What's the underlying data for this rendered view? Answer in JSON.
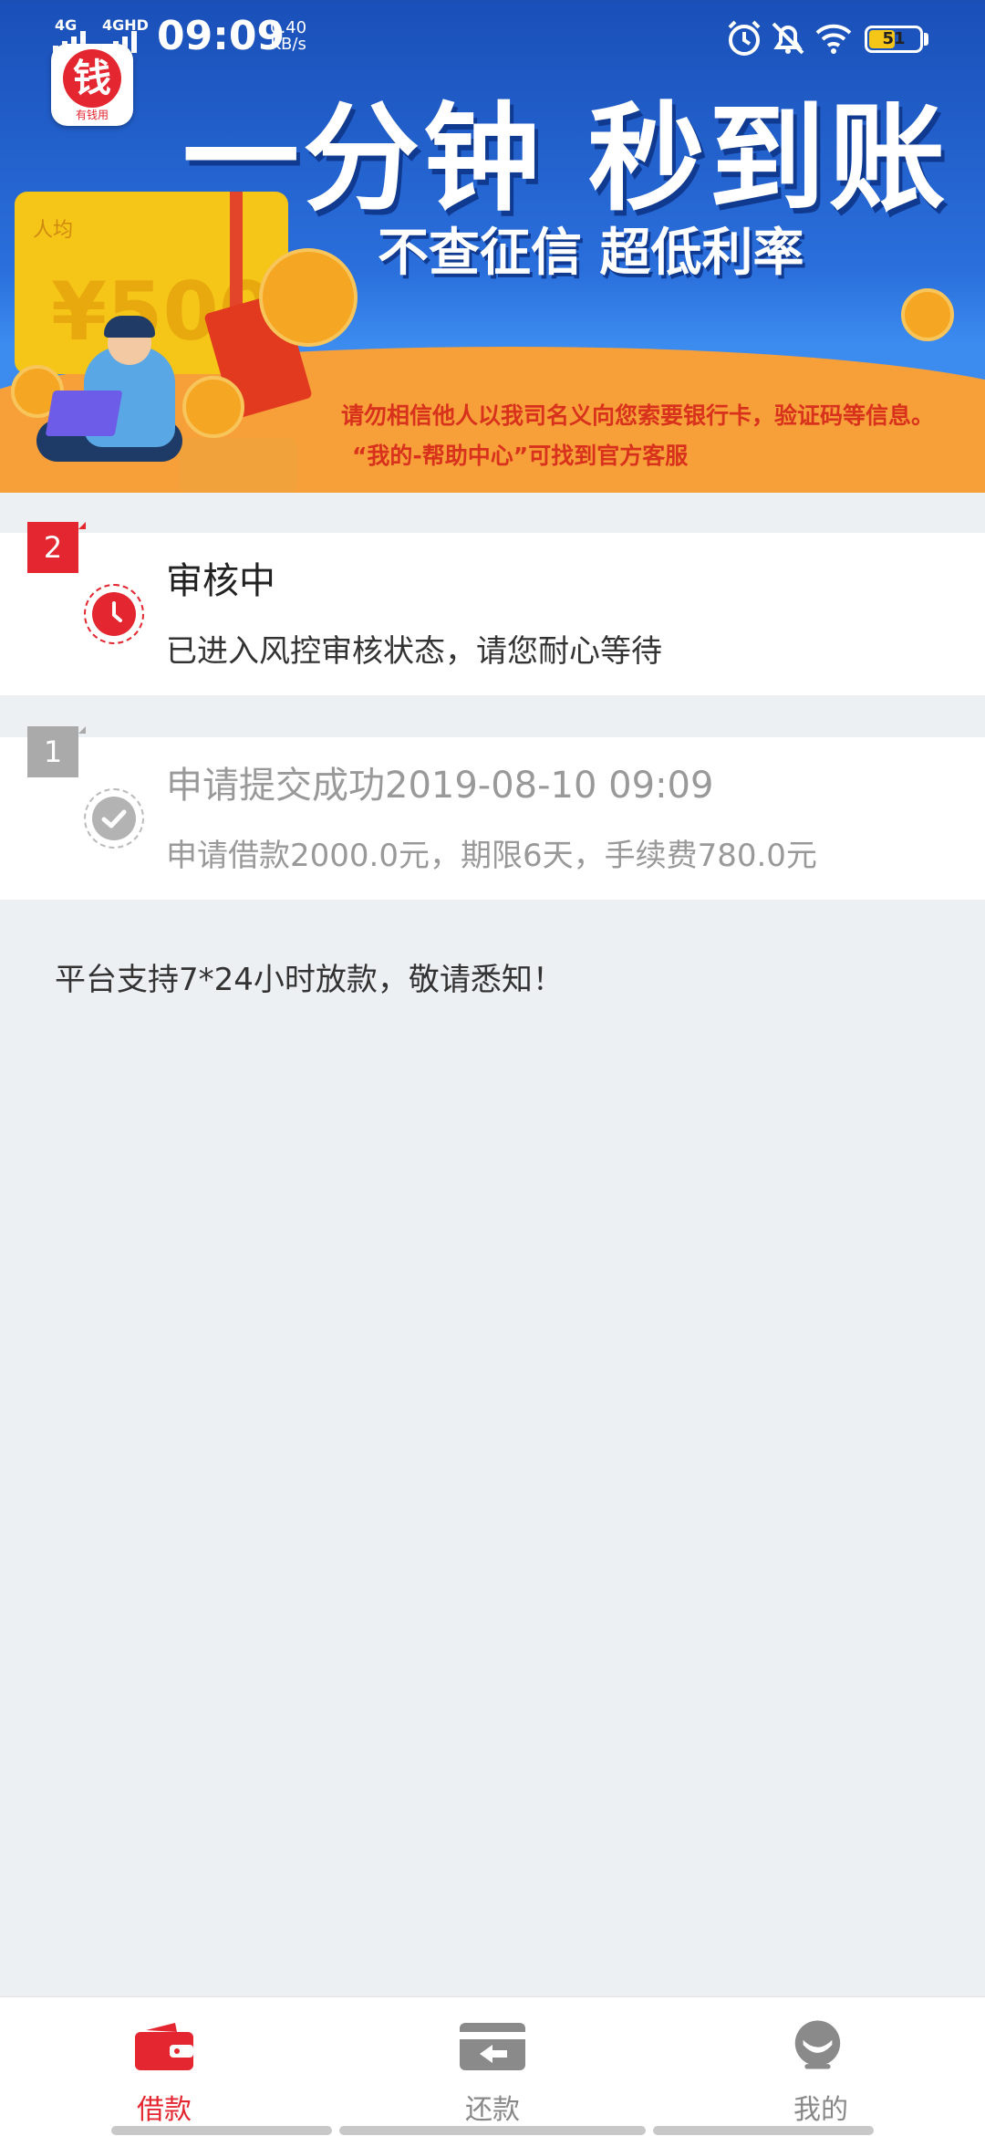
{
  "status_bar": {
    "signal1": "4G",
    "signal2": "4GHD",
    "time": "09:09",
    "net_speed_value": "0.40",
    "net_speed_unit": "KB/s",
    "battery_level": "51",
    "battery_fraction": 0.51,
    "icons": [
      "alarm-icon",
      "mute-bell-icon",
      "wifi-icon",
      "battery-icon"
    ]
  },
  "banner": {
    "app_logo_char": "钱",
    "app_logo_label": "有钱用",
    "title": "一分钟 秒到账",
    "subtitle": "不查征信 超低利率",
    "warning_line1": "请勿相信他人以我司名义向您索要银行卡，验证码等信息。",
    "warning_line2": "“我的-帮助中心”可找到官方客服",
    "card_amount": "¥500",
    "card_label": "人均"
  },
  "steps": [
    {
      "number": "2",
      "title": "审核中",
      "description": "已进入风控审核状态，请您耐心等待",
      "state": "active",
      "icon": "clock-icon",
      "color": "#e3262f"
    },
    {
      "number": "1",
      "title": "申请提交成功2019-08-10 09:09",
      "description": "申请借款2000.0元，期限6天，手续费780.0元",
      "state": "done",
      "icon": "check-icon",
      "color": "#aaaaaa"
    }
  ],
  "notice": "平台支持7*24小时放款，敬请悉知！",
  "nav": {
    "items": [
      {
        "label": "借款",
        "icon": "wallet-icon",
        "active": true
      },
      {
        "label": "还款",
        "icon": "repay-card-icon",
        "active": false
      },
      {
        "label": "我的",
        "icon": "profile-icon",
        "active": false
      }
    ],
    "active_color": "#e3262f",
    "inactive_color": "#888888"
  }
}
